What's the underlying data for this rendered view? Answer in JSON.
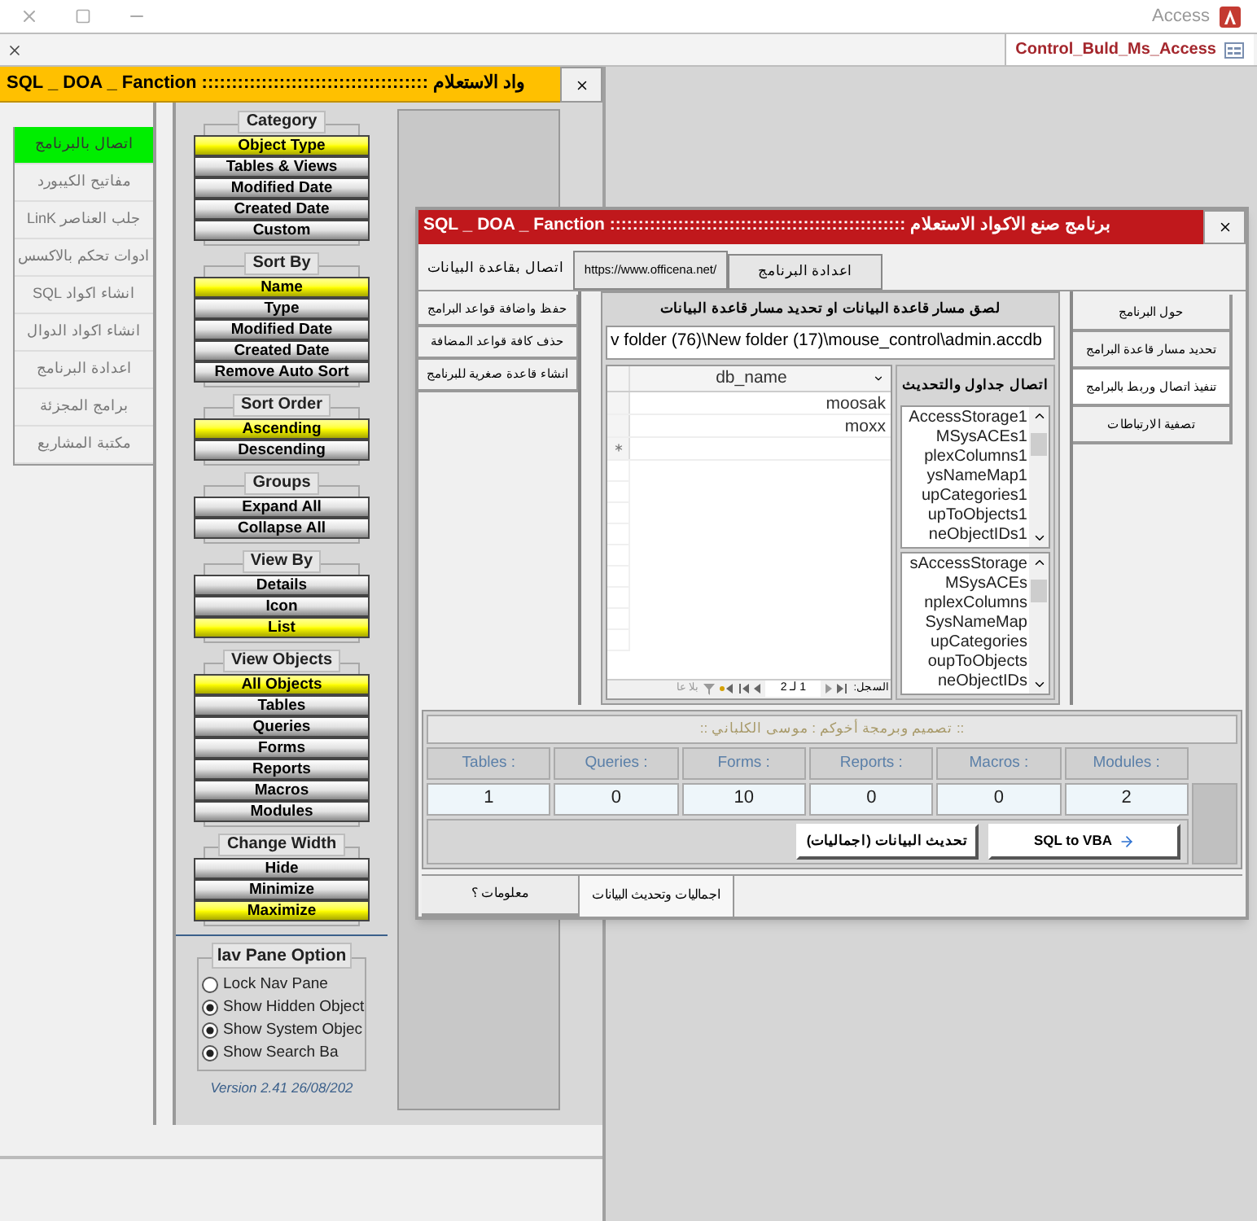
{
  "app": {
    "title": "Access",
    "document_tab": "Control_Buld_Ms_Access"
  },
  "main_form": {
    "title": "SQL _ DOA _ Fanction :::::::::::::::::::::::::::::::::::::: واد الاستعلام",
    "nav_menu": [
      {
        "label": "اتصال بالبرنامج",
        "selected": true
      },
      {
        "label": "مفاتيح الكيبورد",
        "selected": false
      },
      {
        "label": "جلب العناصر LinK",
        "selected": false
      },
      {
        "label": "ادوات تحكم بالاكسس",
        "selected": false
      },
      {
        "label": "انشاء اكواد SQL",
        "selected": false
      },
      {
        "label": "انشاء اكواد الدوال",
        "selected": false
      },
      {
        "label": "اعدادة البرنامج",
        "selected": false
      },
      {
        "label": "برامج المجزئة",
        "selected": false
      },
      {
        "label": "مكتبة المشاريع",
        "selected": false
      }
    ],
    "option_groups": [
      {
        "title": "Category",
        "buttons": [
          {
            "label": "Object Type",
            "selected": true
          },
          {
            "label": "Tables & Views",
            "selected": false
          },
          {
            "label": "Modified Date",
            "selected": false
          },
          {
            "label": "Created Date",
            "selected": false
          },
          {
            "label": "Custom",
            "selected": false
          }
        ]
      },
      {
        "title": "Sort By",
        "buttons": [
          {
            "label": "Name",
            "selected": true
          },
          {
            "label": "Type",
            "selected": false
          },
          {
            "label": "Modified Date",
            "selected": false
          },
          {
            "label": "Created Date",
            "selected": false
          },
          {
            "label": "Remove Auto Sort",
            "selected": false
          }
        ]
      },
      {
        "title": "Sort Order",
        "buttons": [
          {
            "label": "Ascending",
            "selected": true
          },
          {
            "label": "Descending",
            "selected": false
          }
        ]
      },
      {
        "title": "Groups",
        "buttons": [
          {
            "label": "Expand All",
            "selected": false
          },
          {
            "label": "Collapse All",
            "selected": false
          }
        ]
      },
      {
        "title": "View By",
        "buttons": [
          {
            "label": "Details",
            "selected": false
          },
          {
            "label": "Icon",
            "selected": false
          },
          {
            "label": "List",
            "selected": true
          }
        ]
      },
      {
        "title": "View Objects",
        "buttons": [
          {
            "label": "All Objects",
            "selected": true
          },
          {
            "label": "Tables",
            "selected": false
          },
          {
            "label": "Queries",
            "selected": false
          },
          {
            "label": "Forms",
            "selected": false
          },
          {
            "label": "Reports",
            "selected": false
          },
          {
            "label": "Macros",
            "selected": false
          },
          {
            "label": "Modules",
            "selected": false
          }
        ]
      },
      {
        "title": "Change Width",
        "buttons": [
          {
            "label": "Hide",
            "selected": false
          },
          {
            "label": "Minimize",
            "selected": false
          },
          {
            "label": "Maximize",
            "selected": true
          }
        ]
      }
    ],
    "nav_pane_options": {
      "title": "lav Pane Option",
      "options": [
        {
          "label": "Lock Nav Pane",
          "checked": false
        },
        {
          "label": "Show Hidden Object",
          "checked": true
        },
        {
          "label": "Show System Objec",
          "checked": true
        },
        {
          "label": "Show Search Ba",
          "checked": true
        }
      ]
    },
    "version": "Version 2.41   26/08/202"
  },
  "dialog": {
    "title": "SQL _ DOA _ Fanction :::::::::::::::::::::::::::::::::::::::::::::::::::: برنامج صنع الاكواد الاستعلام",
    "top_tabs": [
      {
        "kind": "tab",
        "label": "اعدادة البرنامج",
        "selected": false
      },
      {
        "kind": "link",
        "label": "https://www.officena.net/",
        "selected": false
      },
      {
        "kind": "tab",
        "label": "اتصال بقاعدة البيانات",
        "selected": true
      }
    ],
    "left_buttons": [
      "حفظ واضافة قواعد البرامج",
      "حذف كافة قواعد المضافة",
      "انشاء قاعدة صغرية للبرنامج"
    ],
    "path_prompt": "لصق مسار قاعدة البيانات او تحديد مسار قاعدة البيانات",
    "path_value": "v folder (76)\\New folder (17)\\mouse_control\\admin.accdb",
    "table": {
      "columns": [
        "db_name"
      ],
      "rows": [
        [
          "moosak"
        ],
        [
          "moxx"
        ]
      ]
    },
    "record_nav": {
      "label": "السجل:",
      "position": "1 لـ 2",
      "filter": "بلا عا"
    },
    "link_panel": {
      "title": "اتصال جداول والتحديث",
      "lists": [
        [
          "AccessStorage1",
          "MSysACEs1",
          "plexColumns1",
          "ysNameMap1",
          "upCategories1",
          "upToObjects1",
          "neObjectIDs1"
        ],
        [
          "sAccessStorage",
          "MSysACEs",
          "nplexColumns",
          "SysNameMap",
          "upCategories",
          "oupToObjects",
          "neObjectIDs"
        ]
      ]
    },
    "right_buttons": [
      {
        "label": "حول البرنامج",
        "selected": false
      },
      {
        "label": "تحديد مسار قاعدة البرامج",
        "selected": false
      },
      {
        "label": "تنفيذ اتصال وربط بالبرامج",
        "selected": true
      },
      {
        "label": "تصفية الارتباطات",
        "selected": false
      }
    ],
    "credit": ":: تصميم وبرمجة أخوكم : موسى الكلباني ::",
    "stats": [
      {
        "label": "Tables :",
        "value": "1"
      },
      {
        "label": "Queries :",
        "value": "0"
      },
      {
        "label": "Forms :",
        "value": "10"
      },
      {
        "label": "Reports :",
        "value": "0"
      },
      {
        "label": "Macros :",
        "value": "0"
      },
      {
        "label": "Modules :",
        "value": "2"
      }
    ],
    "actions": [
      {
        "kind": "plain",
        "label": "تحديث البيانات (اجماليات)"
      },
      {
        "kind": "arrow",
        "label": "SQL to VBA"
      }
    ],
    "bottom_tabs": [
      {
        "label": "اجماليات وتحديث البيانات",
        "selected": true
      },
      {
        "label": "معلومات ؟",
        "selected": false
      }
    ]
  }
}
